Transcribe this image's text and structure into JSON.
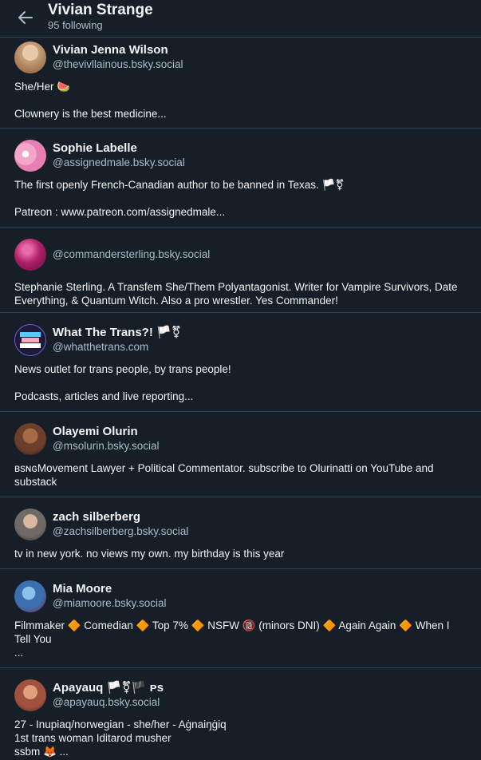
{
  "header": {
    "title": "Vivian Strange",
    "subtitle": "95 following"
  },
  "items": [
    {
      "name": "Vivian Jenna Wilson",
      "handle": "@thevivllainous.bsky.social",
      "bio": "She/Her 🍉\n\nClownery is the best medicine...",
      "avatar_color": "#c7a07a"
    },
    {
      "name": "Sophie Labelle",
      "handle": "@assignedmale.bsky.social",
      "bio": "The first openly French-Canadian author to be banned in Texas. 🏳️⚧\n\nPatreon : www.patreon.com/assignedmale...",
      "avatar_color": "#f3a6c8"
    },
    {
      "name": "",
      "handle": "@commandersterling.bsky.social",
      "bio": "Stephanie Sterling. A Transfem She/Them Polyantagonist. Writer for Vampire Survivors, Date Everything, & Quantum Witch. Also a pro wrestler. Yes Commander!",
      "avatar_color": "#b0216a"
    },
    {
      "name": "What The Trans?! 🏳️⚧",
      "handle": "@whatthetrans.com",
      "bio": "News outlet for trans people, by trans people!\n\nPodcasts, articles and live reporting...",
      "avatar_color": "#1d1a3a"
    },
    {
      "name": "Olayemi Olurin",
      "handle": "@msolurin.bsky.social",
      "bio": "ʙsɴɢMovement Lawyer + Political Commentator. subscribe to Olurinatti on YouTube and substack",
      "avatar_color": "#6b3f2a"
    },
    {
      "name": "zach silberberg",
      "handle": "@zachsilberberg.bsky.social",
      "bio": "tv in new york. no views my own. my birthday is this year",
      "avatar_color": "#6f6a66"
    },
    {
      "name": "Mia Moore",
      "handle": "@miamoore.bsky.social",
      "bio": "Filmmaker 🔶 Comedian 🔶 Top 7% 🔶 NSFW 🔞 (minors DNI) 🔶 Again Again 🔶 When I Tell You\n...",
      "avatar_color": "#3c6fb0"
    },
    {
      "name": "Apayauq 🏳️⚧🏴 ᴘs",
      "handle": "@apayauq.bsky.social",
      "bio": "27 - Inupiaq/norwegian - she/her - Aġnaiŋġiq\n1st trans woman Iditarod musher\nssbm 🦊 ...",
      "avatar_color": "#a0523e"
    }
  ]
}
